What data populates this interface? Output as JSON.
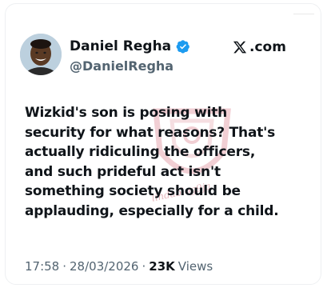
{
  "author": {
    "display_name": "Daniel Regha",
    "handle": "@DanielRegha",
    "verified_icon": "verified-badge-icon",
    "avatar": "avatar"
  },
  "brand": {
    "icon": "x-logo-icon",
    "domain": ".com"
  },
  "tweet": {
    "text": "Wizkid's son is posing with\nsecurity for what reasons? That's\nactually ridiculing the officers,\nand such prideful act isn't\nsomething society should be\napplauding, especially for a child."
  },
  "meta": {
    "time": "17:58",
    "separator": "·",
    "date": "28/03/2026",
    "views_count": "23K",
    "views_label": "Views"
  },
  "watermark": {
    "text": "lindablog9ja"
  },
  "colors": {
    "verified": "#1d9bf0",
    "secondary_text": "#536471",
    "primary_text": "#0f1419",
    "watermark": "#d9737f"
  }
}
